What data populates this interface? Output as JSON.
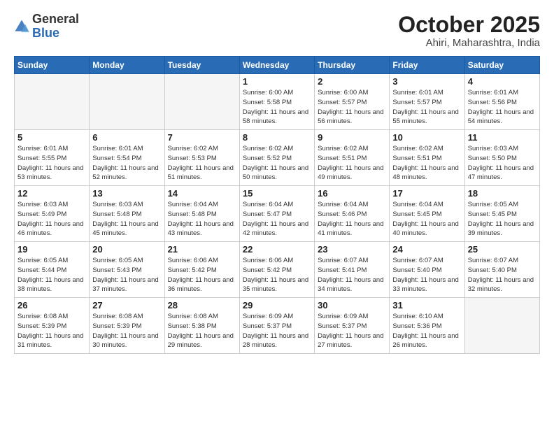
{
  "header": {
    "logo_general": "General",
    "logo_blue": "Blue",
    "title": "October 2025",
    "subtitle": "Ahiri, Maharashtra, India"
  },
  "days_of_week": [
    "Sunday",
    "Monday",
    "Tuesday",
    "Wednesday",
    "Thursday",
    "Friday",
    "Saturday"
  ],
  "weeks": [
    [
      {
        "day": "",
        "info": ""
      },
      {
        "day": "",
        "info": ""
      },
      {
        "day": "",
        "info": ""
      },
      {
        "day": "1",
        "info": "Sunrise: 6:00 AM\nSunset: 5:58 PM\nDaylight: 11 hours and 58 minutes."
      },
      {
        "day": "2",
        "info": "Sunrise: 6:00 AM\nSunset: 5:57 PM\nDaylight: 11 hours and 56 minutes."
      },
      {
        "day": "3",
        "info": "Sunrise: 6:01 AM\nSunset: 5:57 PM\nDaylight: 11 hours and 55 minutes."
      },
      {
        "day": "4",
        "info": "Sunrise: 6:01 AM\nSunset: 5:56 PM\nDaylight: 11 hours and 54 minutes."
      }
    ],
    [
      {
        "day": "5",
        "info": "Sunrise: 6:01 AM\nSunset: 5:55 PM\nDaylight: 11 hours and 53 minutes."
      },
      {
        "day": "6",
        "info": "Sunrise: 6:01 AM\nSunset: 5:54 PM\nDaylight: 11 hours and 52 minutes."
      },
      {
        "day": "7",
        "info": "Sunrise: 6:02 AM\nSunset: 5:53 PM\nDaylight: 11 hours and 51 minutes."
      },
      {
        "day": "8",
        "info": "Sunrise: 6:02 AM\nSunset: 5:52 PM\nDaylight: 11 hours and 50 minutes."
      },
      {
        "day": "9",
        "info": "Sunrise: 6:02 AM\nSunset: 5:51 PM\nDaylight: 11 hours and 49 minutes."
      },
      {
        "day": "10",
        "info": "Sunrise: 6:02 AM\nSunset: 5:51 PM\nDaylight: 11 hours and 48 minutes."
      },
      {
        "day": "11",
        "info": "Sunrise: 6:03 AM\nSunset: 5:50 PM\nDaylight: 11 hours and 47 minutes."
      }
    ],
    [
      {
        "day": "12",
        "info": "Sunrise: 6:03 AM\nSunset: 5:49 PM\nDaylight: 11 hours and 46 minutes."
      },
      {
        "day": "13",
        "info": "Sunrise: 6:03 AM\nSunset: 5:48 PM\nDaylight: 11 hours and 45 minutes."
      },
      {
        "day": "14",
        "info": "Sunrise: 6:04 AM\nSunset: 5:48 PM\nDaylight: 11 hours and 43 minutes."
      },
      {
        "day": "15",
        "info": "Sunrise: 6:04 AM\nSunset: 5:47 PM\nDaylight: 11 hours and 42 minutes."
      },
      {
        "day": "16",
        "info": "Sunrise: 6:04 AM\nSunset: 5:46 PM\nDaylight: 11 hours and 41 minutes."
      },
      {
        "day": "17",
        "info": "Sunrise: 6:04 AM\nSunset: 5:45 PM\nDaylight: 11 hours and 40 minutes."
      },
      {
        "day": "18",
        "info": "Sunrise: 6:05 AM\nSunset: 5:45 PM\nDaylight: 11 hours and 39 minutes."
      }
    ],
    [
      {
        "day": "19",
        "info": "Sunrise: 6:05 AM\nSunset: 5:44 PM\nDaylight: 11 hours and 38 minutes."
      },
      {
        "day": "20",
        "info": "Sunrise: 6:05 AM\nSunset: 5:43 PM\nDaylight: 11 hours and 37 minutes."
      },
      {
        "day": "21",
        "info": "Sunrise: 6:06 AM\nSunset: 5:42 PM\nDaylight: 11 hours and 36 minutes."
      },
      {
        "day": "22",
        "info": "Sunrise: 6:06 AM\nSunset: 5:42 PM\nDaylight: 11 hours and 35 minutes."
      },
      {
        "day": "23",
        "info": "Sunrise: 6:07 AM\nSunset: 5:41 PM\nDaylight: 11 hours and 34 minutes."
      },
      {
        "day": "24",
        "info": "Sunrise: 6:07 AM\nSunset: 5:40 PM\nDaylight: 11 hours and 33 minutes."
      },
      {
        "day": "25",
        "info": "Sunrise: 6:07 AM\nSunset: 5:40 PM\nDaylight: 11 hours and 32 minutes."
      }
    ],
    [
      {
        "day": "26",
        "info": "Sunrise: 6:08 AM\nSunset: 5:39 PM\nDaylight: 11 hours and 31 minutes."
      },
      {
        "day": "27",
        "info": "Sunrise: 6:08 AM\nSunset: 5:39 PM\nDaylight: 11 hours and 30 minutes."
      },
      {
        "day": "28",
        "info": "Sunrise: 6:08 AM\nSunset: 5:38 PM\nDaylight: 11 hours and 29 minutes."
      },
      {
        "day": "29",
        "info": "Sunrise: 6:09 AM\nSunset: 5:37 PM\nDaylight: 11 hours and 28 minutes."
      },
      {
        "day": "30",
        "info": "Sunrise: 6:09 AM\nSunset: 5:37 PM\nDaylight: 11 hours and 27 minutes."
      },
      {
        "day": "31",
        "info": "Sunrise: 6:10 AM\nSunset: 5:36 PM\nDaylight: 11 hours and 26 minutes."
      },
      {
        "day": "",
        "info": ""
      }
    ]
  ]
}
